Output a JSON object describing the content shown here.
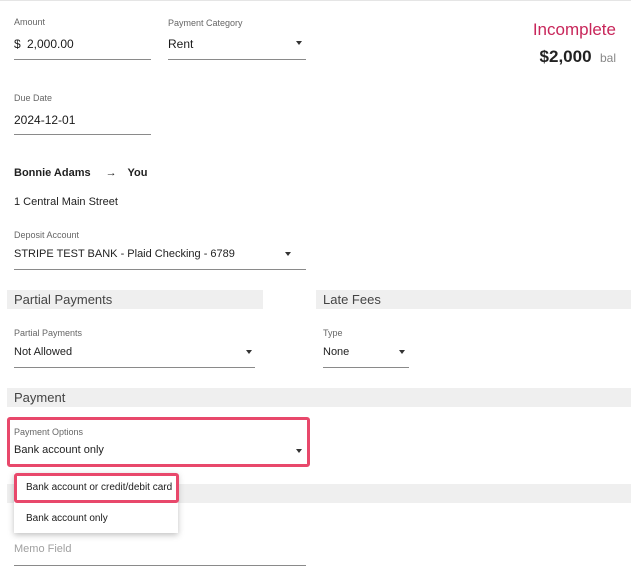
{
  "amount": {
    "label": "Amount",
    "currency": "$",
    "value": "2,000.00"
  },
  "payment_category": {
    "label": "Payment Category",
    "value": "Rent"
  },
  "status": {
    "text": "Incomplete",
    "balance": "$2,000",
    "balance_suffix": "bal"
  },
  "due_date": {
    "label": "Due Date",
    "value": "2024-12-01"
  },
  "parties": {
    "from": "Bonnie Adams",
    "arrow": "→",
    "to": "You"
  },
  "address": "1 Central Main Street",
  "deposit_account": {
    "label": "Deposit Account",
    "value": "STRIPE TEST BANK - Plaid Checking - 6789"
  },
  "sections": {
    "partial_payments": "Partial Payments",
    "late_fees": "Late Fees",
    "payment": "Payment"
  },
  "partial_payments": {
    "label": "Partial Payments",
    "value": "Not Allowed"
  },
  "late_fee_type": {
    "label": "Type",
    "value": "None"
  },
  "payment_options": {
    "label": "Payment Options",
    "value": "Bank account only",
    "menu": [
      "Bank account or credit/debit card",
      "Bank account only"
    ]
  },
  "memo": {
    "placeholder": "Memo Field"
  },
  "colors": {
    "accent": "#e8486b",
    "status": "#c8265a",
    "section_bg": "#efefef"
  }
}
